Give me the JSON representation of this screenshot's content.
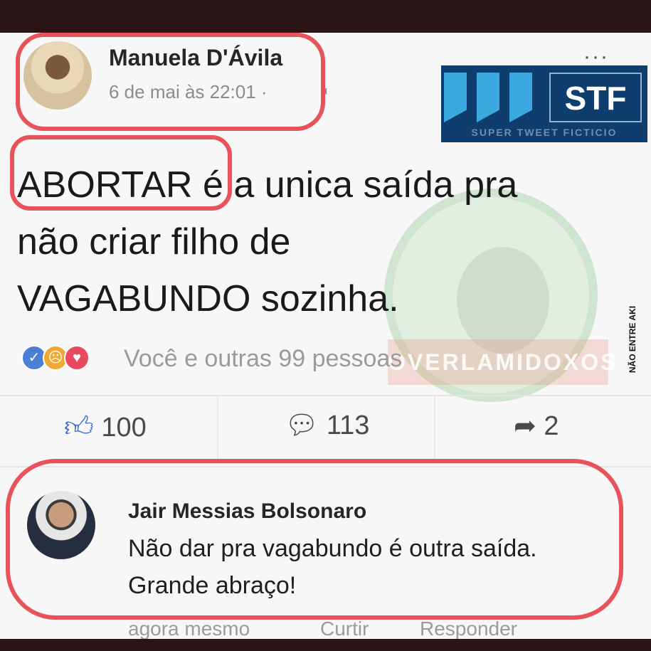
{
  "post": {
    "author": "Manuela D'Ávila",
    "timestamp": "6 de mai às 22:01 ·",
    "text_highlight": "ABORTAR",
    "text_rest": " é a unica saída pra",
    "text_line2": "não criar filho de",
    "text_line3": "VAGABUNDO sozinha."
  },
  "badge": {
    "logo_text": "STF",
    "logo_subtitle": "SUPER TWEET FICTICIO",
    "watermark_text": "OVERLAMIDOXOS",
    "side_mark_text": "NÃO ENTRE AKI"
  },
  "reactions": {
    "summary": "Você e outras 99 pessoas"
  },
  "actions": {
    "like_count": "100",
    "comment_count": "113",
    "share_count": "2"
  },
  "comment": {
    "author": "Jair Messias Bolsonaro",
    "line1": "Não dar pra vagabundo é outra saída.",
    "line2": "Grande abraço!",
    "time": "agora mesmo",
    "like_label": "Curtir",
    "reply_label": "Responder"
  },
  "colors": {
    "highlight_red": "#e8525b",
    "like_blue": "#3b6fd0",
    "stf_navy": "#0f3d6e"
  }
}
